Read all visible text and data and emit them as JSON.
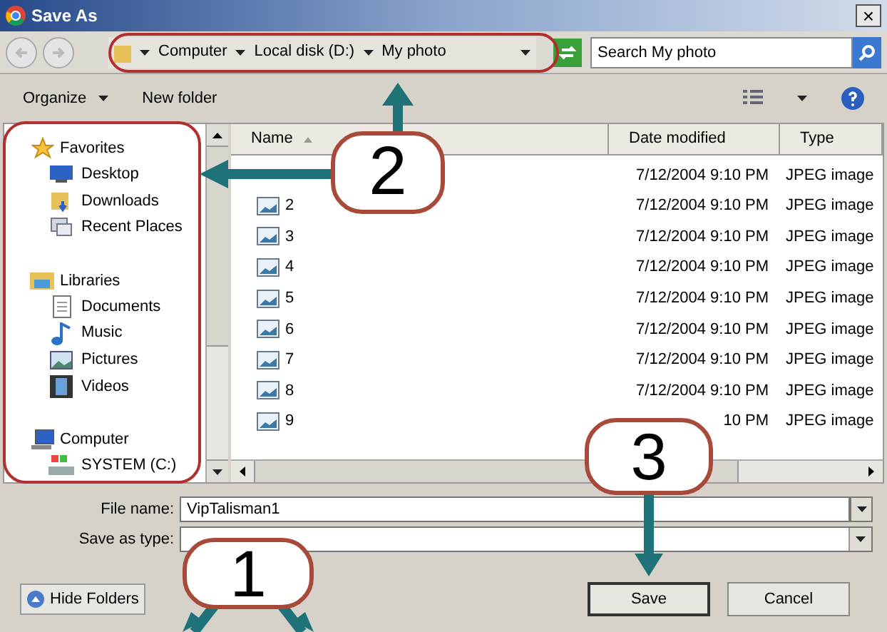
{
  "window": {
    "title": "Save As",
    "close": "×"
  },
  "address": {
    "crumbs": [
      "Computer",
      "Local disk (D:)",
      "My photo"
    ],
    "search_placeholder": "Search My photo"
  },
  "toolbar": {
    "organize": "Organize",
    "new_folder": "New folder"
  },
  "sidebar": {
    "groups": [
      {
        "label": "Favorites",
        "kind": "star",
        "children": [
          {
            "label": "Desktop",
            "kind": "desktop"
          },
          {
            "label": "Downloads",
            "kind": "downloads"
          },
          {
            "label": "Recent Places",
            "kind": "recent"
          }
        ]
      },
      {
        "label": "Libraries",
        "kind": "libraries",
        "children": [
          {
            "label": "Documents",
            "kind": "document"
          },
          {
            "label": "Music",
            "kind": "music"
          },
          {
            "label": "Pictures",
            "kind": "pictures"
          },
          {
            "label": "Videos",
            "kind": "videos"
          }
        ]
      },
      {
        "label": "Computer",
        "kind": "computer",
        "children": [
          {
            "label": "SYSTEM (C:)",
            "kind": "drive"
          }
        ]
      }
    ]
  },
  "table": {
    "columns": [
      "Name",
      "Date modified",
      "Type"
    ],
    "rows": [
      {
        "date": "7/12/2004 9:10 PM",
        "type": "JPEG image"
      },
      {
        "name": "2",
        "date": "7/12/2004 9:10 PM",
        "type": "JPEG image"
      },
      {
        "name": "3",
        "date": "7/12/2004 9:10 PM",
        "type": "JPEG image"
      },
      {
        "name": "4",
        "date": "7/12/2004 9:10 PM",
        "type": "JPEG image"
      },
      {
        "name": "5",
        "date": "7/12/2004 9:10 PM",
        "type": "JPEG image"
      },
      {
        "name": "6",
        "date": "7/12/2004 9:10 PM",
        "type": "JPEG image"
      },
      {
        "name": "7",
        "date": "7/12/2004 9:10 PM",
        "type": "JPEG image"
      },
      {
        "name": "8",
        "date": "7/12/2004 9:10 PM",
        "type": "JPEG image"
      },
      {
        "name": "9",
        "date": "10 PM",
        "type": "JPEG image"
      }
    ]
  },
  "form": {
    "file_name_label": "File name:",
    "file_name": "VipTalisman1",
    "type_label": "Save as type:"
  },
  "buttons": {
    "hide_folders": "Hide Folders",
    "save": "Save",
    "cancel": "Cancel"
  },
  "annotations": [
    {
      "label": "2"
    },
    {
      "label": "3"
    },
    {
      "label": "1"
    }
  ]
}
